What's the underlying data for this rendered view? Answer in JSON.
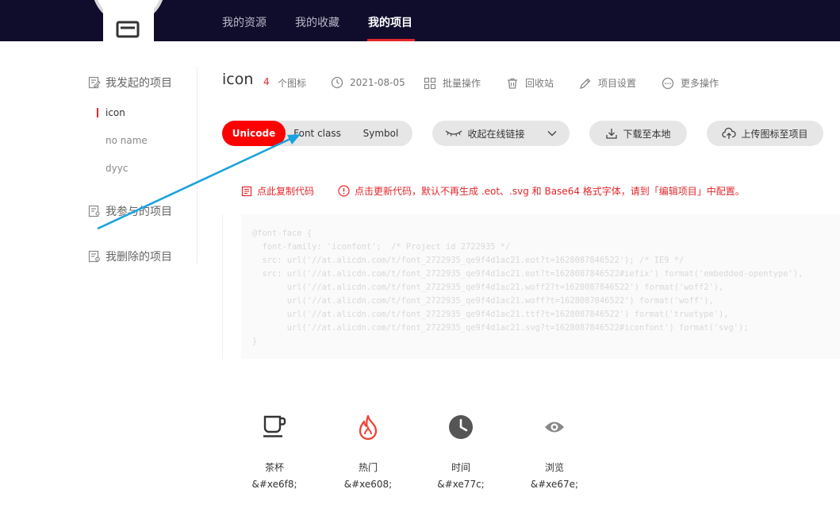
{
  "nav": {
    "items": [
      {
        "label": "我的资源"
      },
      {
        "label": "我的收藏"
      },
      {
        "label": "我的项目"
      }
    ]
  },
  "sidebar": {
    "initiated": "我发起的项目",
    "projects": [
      "icon",
      "no name",
      "dyyc"
    ],
    "joined": "我参与的项目",
    "deleted": "我删除的项目"
  },
  "project": {
    "name": "icon",
    "icon_count": "4",
    "icon_count_label": "个图标",
    "date": "2021-08-05",
    "batch": "批量操作",
    "recycle": "回收站",
    "settings": "项目设置",
    "more": "更多操作"
  },
  "tabs": [
    "Unicode",
    "Font class",
    "Symbol"
  ],
  "buttons": {
    "collapse_link": "收起在线链接",
    "download": "下载至本地",
    "upload": "上传图标至项目"
  },
  "notices": {
    "copy": "点此复制代码",
    "update": "点击更新代码，默认不再生成 .eot、.svg 和 Base64 格式字体，请到「编辑项目」中配置。"
  },
  "code": "@font-face {\n  font-family: 'iconfont';  /* Project id 2722935 */\n  src: url('//at.alicdn.com/t/font_2722935_qe9f4d1ac21.eot?t=1628087846522'); /* IE9 */\n  src: url('//at.alicdn.com/t/font_2722935_qe9f4d1ac21.eot?t=1628087846522#iefix') format('embedded-opentype'),\n       url('//at.alicdn.com/t/font_2722935_qe9f4d1ac21.woff2?t=1628087846522') format('woff2'),\n       url('//at.alicdn.com/t/font_2722935_qe9f4d1ac21.woff?t=1628087846522') format('woff'),\n       url('//at.alicdn.com/t/font_2722935_qe9f4d1ac21.ttf?t=1628087846522') format('truetype'),\n       url('//at.alicdn.com/t/font_2722935_qe9f4d1ac21.svg?t=1628087846522#iconfont') format('svg');\n}",
  "icons": [
    {
      "name": "茶杯",
      "code": "&#xe6f8;",
      "icon": "cup-icon",
      "color": "#333333"
    },
    {
      "name": "热门",
      "code": "&#xe608;",
      "icon": "flame-icon",
      "color": "#f04134"
    },
    {
      "name": "时间",
      "code": "&#xe77c;",
      "icon": "clock-icon",
      "color": "#555555"
    },
    {
      "name": "浏览",
      "code": "&#xe67e;",
      "icon": "eye-icon",
      "color": "#888888"
    }
  ],
  "colors": {
    "topbar": "#100d2c",
    "accent": "#ff0000",
    "annotation_arrow": "#1aa3de"
  }
}
